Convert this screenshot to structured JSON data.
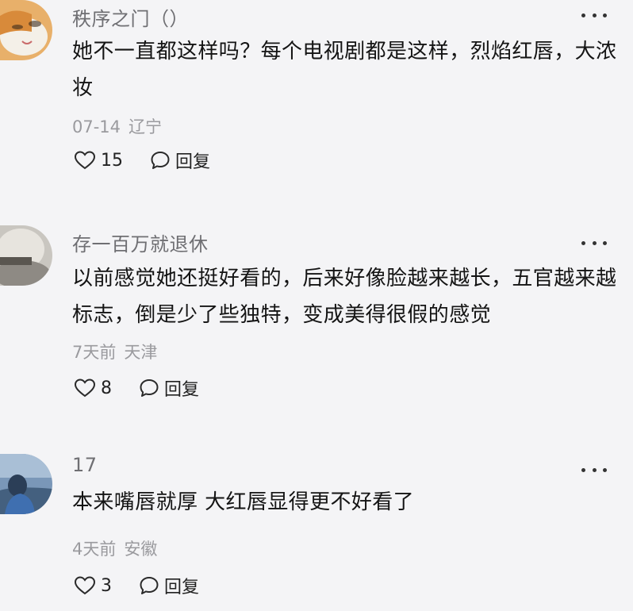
{
  "comments": [
    {
      "username": "秩序之门（）",
      "text": "她不一直都这样吗？每个电视剧都是这样，烈焰红唇，大浓妆",
      "date": "07-14",
      "location": "辽宁",
      "likes": "15",
      "reply_label": "回复"
    },
    {
      "username": "存一百万就退休",
      "text": "以前感觉她还挺好看的，后来好像脸越来越长，五官越来越标志，倒是少了些独特，变成美得很假的感觉",
      "date": "7天前",
      "location": "天津",
      "likes": "8",
      "reply_label": "回复"
    },
    {
      "username": "17",
      "text": "本来嘴唇就厚 大红唇显得更不好看了",
      "date": "4天前",
      "location": "安徽",
      "likes": "3",
      "reply_label": "回复"
    }
  ],
  "icons": {
    "more": "more-dots-icon",
    "like": "heart-outline-icon",
    "reply": "speech-bubble-icon"
  }
}
